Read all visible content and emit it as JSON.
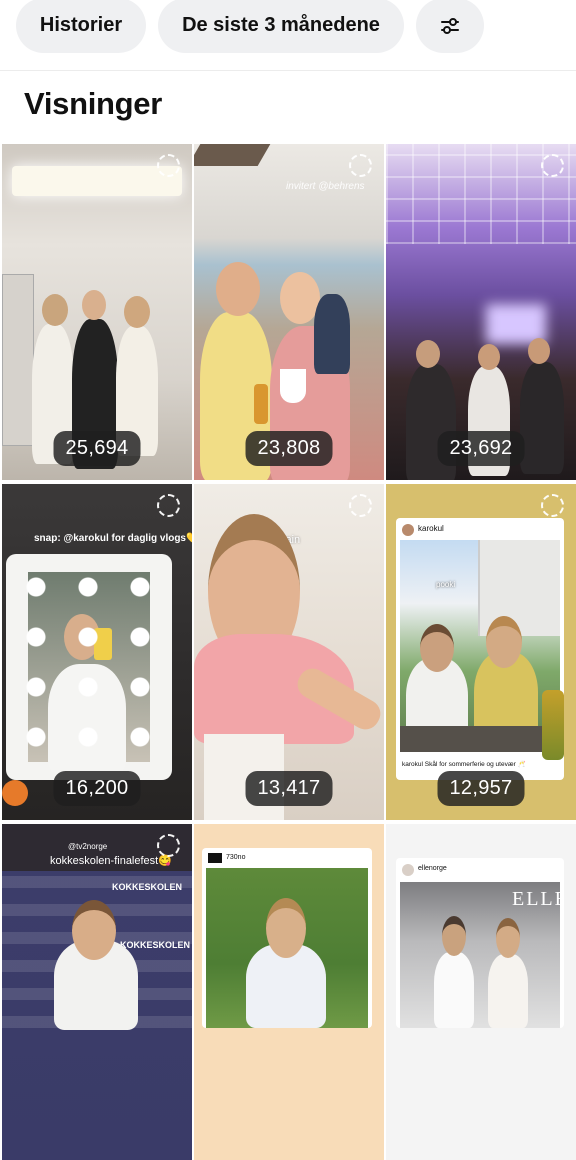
{
  "filters": {
    "history_label": "Historier",
    "period_label": "De siste 3 månedene",
    "filter_icon": "sliders-icon"
  },
  "section": {
    "title": "Visninger"
  },
  "tiles": [
    {
      "views": "25,694"
    },
    {
      "views": "23,808",
      "caption": "invitert @behrens"
    },
    {
      "views": "23,692"
    },
    {
      "views": "16,200",
      "caption": "snap: @karokul for daglig vlogs💛"
    },
    {
      "views": "13,417",
      "caption": "Spain"
    },
    {
      "views": "12,957",
      "username": "karokul",
      "label": "pooki",
      "caption": "karokul Skål for sommerferie og utevær 🥂"
    },
    {
      "views": "",
      "username": "@tv2norge",
      "caption": "kokkeskolen-finalefest😋",
      "backdrop_text": "KOKKESKOLEN"
    },
    {
      "views": "",
      "username": "730no"
    },
    {
      "views": "",
      "username": "ellenorge",
      "backdrop_text": "ELLE"
    }
  ]
}
